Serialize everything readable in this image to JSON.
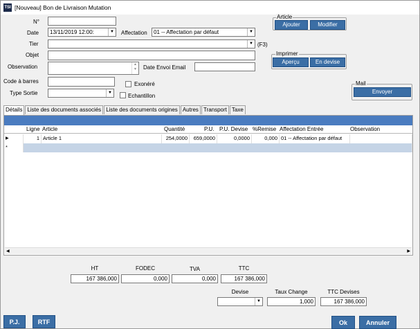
{
  "window": {
    "title": "[Nouveau] Bon de Livraison Mutation",
    "logo_text": "TSI"
  },
  "form": {
    "num_label": "N°",
    "num_value": "",
    "date_label": "Date",
    "date_value": "13/11/2019 12:00:",
    "affectation_label": "Affectation",
    "affectation_value": "01 -- Affectation par défaut",
    "tier_label": "Tier",
    "tier_value": "",
    "tier_hint": "(F3)",
    "objet_label": "Objet",
    "objet_value": "",
    "observation_label": "Observation",
    "observation_value": "",
    "date_envoi_label": "Date Envoi Email",
    "date_envoi_value": "",
    "code_barres_label": "Code à barres",
    "code_barres_value": "",
    "exonere_label": "Exonéré",
    "type_sortie_label": "Type Sortie",
    "type_sortie_value": "",
    "echantillon_label": "Echantillon"
  },
  "groups": {
    "article": {
      "title": "Article",
      "ajouter": "Ajouter",
      "modifier": "Modifier"
    },
    "imprimer": {
      "title": "Imprimer",
      "apercu": "Aperçu",
      "en_devise": "En devise"
    },
    "mail": {
      "title": "Mail",
      "envoyer": "Envoyer"
    }
  },
  "tabs": [
    "Détails",
    "Liste des documents associés",
    "Liste des documents origines",
    "Autres",
    "Transport",
    "Taxe"
  ],
  "grid": {
    "columns": [
      "Ligne",
      "Article",
      "Quantité",
      "P.U.",
      "P.U. Devise",
      "%Remise",
      "Affectation Entrée",
      "Observation"
    ],
    "rows": [
      [
        "1",
        "Article 1",
        "254,0000",
        "659,0000",
        "0,0000",
        "0,000",
        "01 -- Affectation par défaut",
        ""
      ]
    ],
    "new_row_marker": "*",
    "current_row_marker": "▶"
  },
  "totals": {
    "ht_label": "HT",
    "ht_value": "167 386,000",
    "fodec_label": "FODEC",
    "fodec_value": "0,000",
    "tva_label": "TVA",
    "tva_value": "0,000",
    "ttc_label": "TTC",
    "ttc_value": "167 386,000",
    "devise_label": "Devise",
    "devise_value": "",
    "taux_label": "Taux Change",
    "taux_value": "1,000",
    "ttc_devises_label": "TTC Devises",
    "ttc_devises_value": "167 386,000"
  },
  "footer": {
    "pj": "P.J.",
    "rtf": "RTF",
    "ok": "Ok",
    "annuler": "Annuler"
  },
  "colors": {
    "accent": "#3b6ea5",
    "grid_header": "#4a7cc0",
    "new_row": "#c5d4e6"
  }
}
